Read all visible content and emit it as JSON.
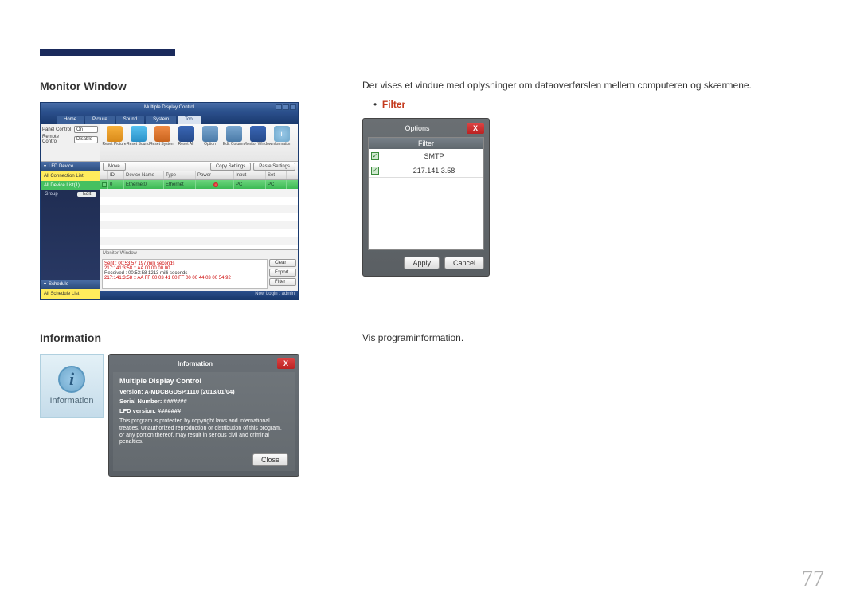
{
  "page_number": "77",
  "section_monitor_title": "Monitor Window",
  "section_info_title": "Information",
  "desc_monitor": "Der vises et vindue med oplysninger om dataoverførslen mellem computeren og skærmene.",
  "desc_info": "Vis programinformation.",
  "bullet_filter_label": "Filter",
  "bullet_dot": "•",
  "app": {
    "title": "Multiple Display Control",
    "tabs": {
      "home": "Home",
      "picture": "Picture",
      "sound": "Sound",
      "system": "System",
      "tool": "Tool"
    },
    "panel": {
      "panel_control_label": "Panel Control",
      "panel_control_value": "On",
      "remote_control_label": "Remote Control",
      "remote_control_value": "Disable"
    },
    "toolbar": {
      "reset_picture": "Reset Picture",
      "reset_sound": "Reset Sound",
      "reset_system": "Reset System",
      "reset_all": "Reset All",
      "option": "Option",
      "edit_column": "Edit Column",
      "monitor_window": "Monitor Window",
      "information": "Information"
    },
    "btns": {
      "move": "Move",
      "copy_settings": "Copy Settings",
      "paste_settings": "Paste Settings"
    },
    "sidebar": {
      "lfd_device": "LFD Device",
      "all_conn_list": "All Connection List",
      "all_device_list": "All Device List(1)",
      "group": "Group",
      "edit_btn": "- Edit -",
      "schedule": "Schedule",
      "all_sched_list": "All Schedule List"
    },
    "grid": {
      "h_id": "ID",
      "h_devname": "Device Name",
      "h_type": "Type",
      "h_power": "Power",
      "h_input": "Input",
      "h_set": "Set",
      "row0": {
        "id": "0",
        "devname": "Ethernet0",
        "type": "Ethernet",
        "power": "",
        "input": "PC",
        "set": "PC"
      }
    },
    "monitor_pane": {
      "title": "Monitor Window",
      "log1": "Sent : 00:53:57 197 milli seconds",
      "log2": "217:141:3:58 :: AA 00 00 00 00",
      "log3": "Received : 00:53:58 1213 milli seconds",
      "log4": "217:141:3:58 :: AA FF 00 03 41 00 FF 00 00 44 03 00 54 92",
      "btn_clear": "Clear",
      "btn_export": "Export",
      "btn_filter": "Filter"
    },
    "status": "Now Login : admin"
  },
  "filter_dlg": {
    "title": "Options",
    "col_filter": "Filter",
    "row1": "SMTP",
    "row2": "217.141.3.58",
    "btn_apply": "Apply",
    "btn_cancel": "Cancel",
    "close_x": "X"
  },
  "info_tile": {
    "icon_char": "i",
    "label": "Information"
  },
  "info_dlg": {
    "title": "Information",
    "close_x": "X",
    "heading": "Multiple Display Control",
    "version_label": "Version: A-MDCBGDSP.1110 (2013/01/04)",
    "serial_label": "Serial Number: #######",
    "lfd_label": "LFD version: #######",
    "legal": "This program is protected by copyright laws and international treaties. Unauthorized reproduction or distribution of this program, or any portion thereof, may result in serious civil and criminal penalties.",
    "btn_close": "Close"
  }
}
